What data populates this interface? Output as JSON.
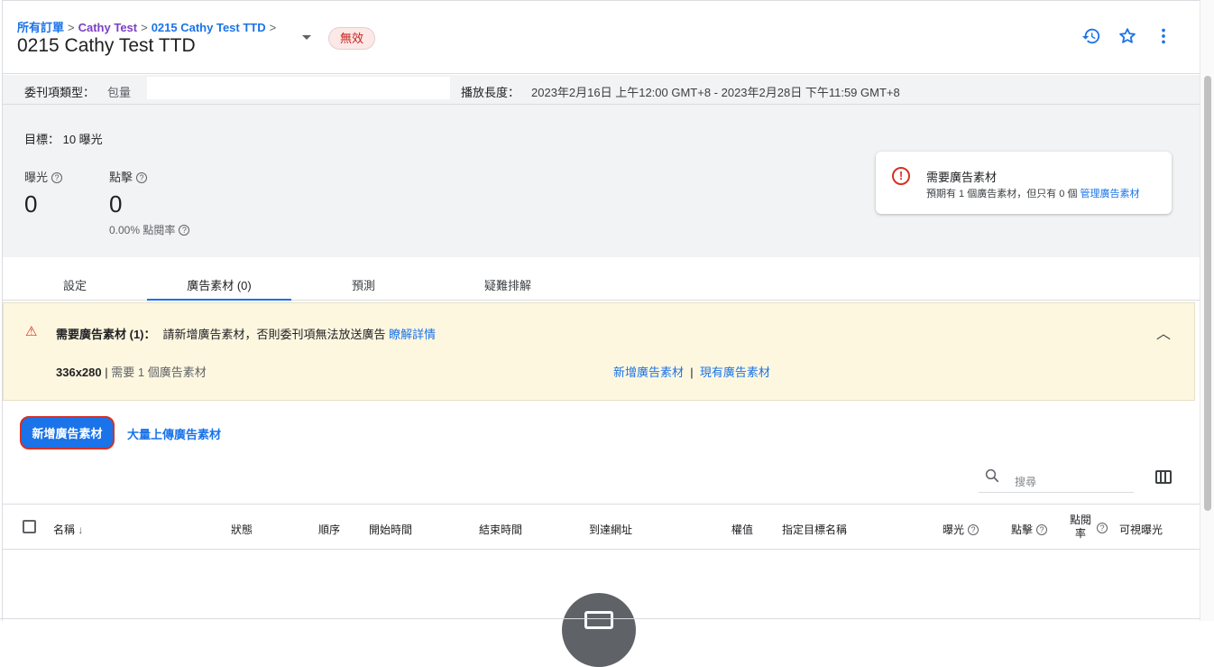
{
  "header": {
    "breadcrumb": [
      "所有訂單",
      "Cathy Test",
      "0215 Cathy Test TTD"
    ],
    "title": "0215 Cathy Test TTD",
    "status": "無效",
    "icons": [
      "history-icon",
      "star-icon",
      "more-vert-icon"
    ]
  },
  "info": {
    "type_label": "委刊項類型：",
    "type_value": "包量",
    "duration_label": "播放長度：",
    "duration_value": "2023年2月16日 上午12:00 GMT+8 - 2023年2月28日 下午11:59 GMT+8"
  },
  "stats": {
    "goal": "目標： 10 曝光",
    "impressions_label": "曝光",
    "impressions_value": "0",
    "clicks_label": "點擊",
    "clicks_value": "0",
    "ctr": "0.00%",
    "ctr_label": "點閱率"
  },
  "alert": {
    "title": "需要廣告素材",
    "desc": "預期有 1 個廣告素材，但只有 0 個",
    "link": "管理廣告素材"
  },
  "tabs": [
    {
      "label": "設定"
    },
    {
      "label": "廣告素材 (0)",
      "active": true
    },
    {
      "label": "預測"
    },
    {
      "label": "疑難排解"
    }
  ],
  "banner": {
    "title": "需要廣告素材 (1)：",
    "message": "請新增廣告素材，否則委刊項無法放送廣告",
    "learn_more": "瞭解詳情",
    "size": "336x280",
    "size_note": "需要 1 個廣告素材",
    "add_link": "新增廣告素材",
    "sep": "|",
    "existing_link": "現有廣告素材"
  },
  "actions": {
    "add_button": "新增廣告素材",
    "bulk_upload": "大量上傳廣告素材"
  },
  "search": {
    "placeholder": "搜尋"
  },
  "table": {
    "columns": [
      "名稱",
      "狀態",
      "順序",
      "開始時間",
      "結束時間",
      "到達網址",
      "權值",
      "指定目標名稱",
      "曝光",
      "點擊",
      "點閱\n率",
      "可視曝光"
    ]
  },
  "colors": {
    "accent": "#1a73e8",
    "error": "#d93025",
    "banner_bg": "#fef7e0"
  }
}
